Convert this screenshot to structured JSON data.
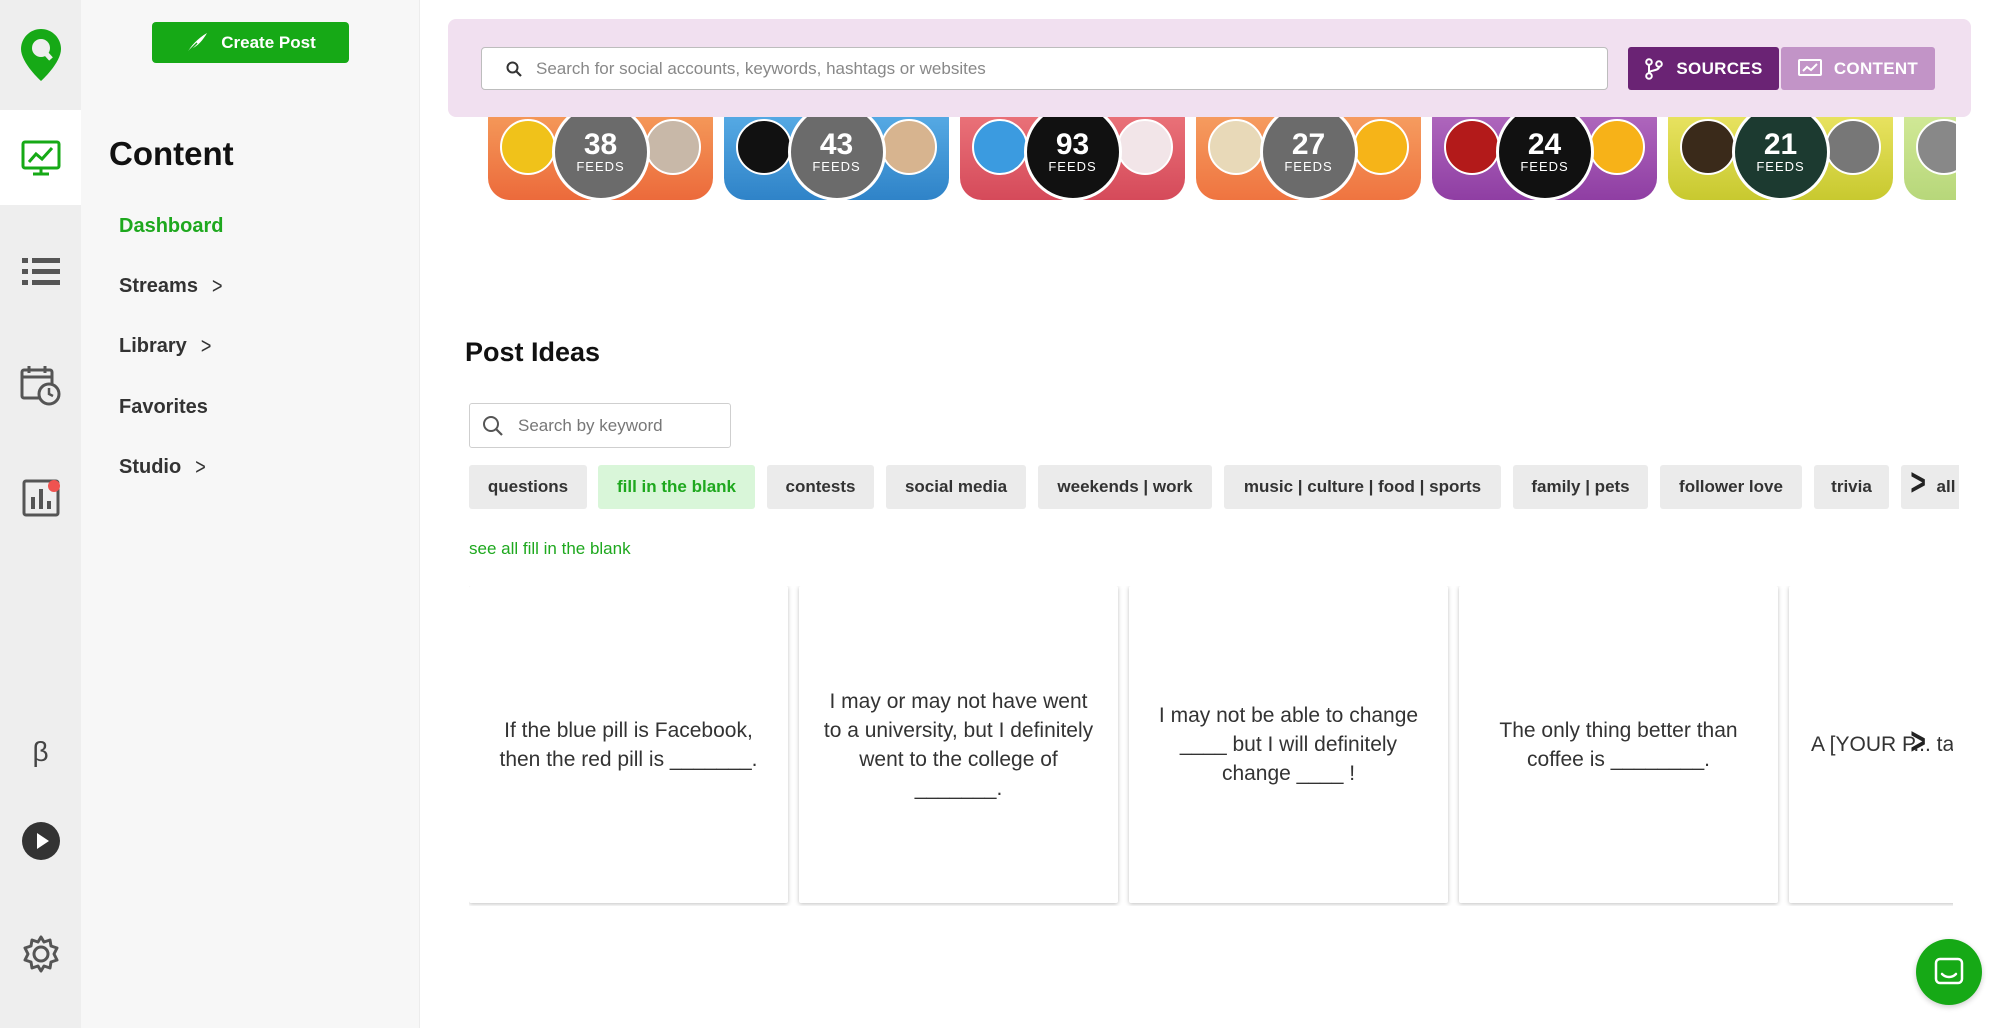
{
  "topbar": {
    "search_placeholder": "Search for social accounts, keywords, hashtags or websites",
    "sources_label": "SOURCES",
    "content_label": "CONTENT"
  },
  "sidebar": {
    "create_post_label": "Create Post",
    "section_title": "Content",
    "items": [
      {
        "label": "Dashboard",
        "active": true,
        "has_chevron": false
      },
      {
        "label": "Streams",
        "active": false,
        "has_chevron": true
      },
      {
        "label": "Library",
        "active": false,
        "has_chevron": true
      },
      {
        "label": "Favorites",
        "active": false,
        "has_chevron": false
      },
      {
        "label": "Studio",
        "active": false,
        "has_chevron": true
      }
    ]
  },
  "rail": {
    "beta_label": "β"
  },
  "feeds": [
    {
      "count": "38",
      "label": "FEEDS",
      "color": "#f07f4a"
    },
    {
      "count": "43",
      "label": "FEEDS",
      "color": "#3d94d6"
    },
    {
      "count": "93",
      "label": "FEEDS",
      "color": "#dd5e68"
    },
    {
      "count": "27",
      "label": "FEEDS",
      "color": "#f08a4c"
    },
    {
      "count": "24",
      "label": "FEEDS",
      "color": "#9c4cae"
    },
    {
      "count": "21",
      "label": "FEEDS",
      "color": "#cfcf3a"
    }
  ],
  "post_ideas": {
    "title": "Post Ideas",
    "search_placeholder": "Search by keyword",
    "categories": [
      "questions",
      "fill in the blank",
      "contests",
      "social media",
      "weekends | work",
      "music | culture | food | sports",
      "family | pets",
      "follower love",
      "trivia",
      "all"
    ],
    "selected_category": "fill in the blank",
    "see_all_label": "see all fill in the blank",
    "cards": [
      "If the blue pill is Facebook, then the red pill is _______.",
      "I may or may not have went to a university, but I definitely went to the college of _______.",
      "I may not be able to change ____ but I will definitely change ____ !",
      "The only thing better than coffee is ________.",
      "A [YOUR P... tastes like..."
    ]
  },
  "colors": {
    "brand_green": "#16a916",
    "sources_purple": "#6a2374",
    "content_purple": "#c294c7",
    "topbar_bg": "#f1e0f0"
  }
}
